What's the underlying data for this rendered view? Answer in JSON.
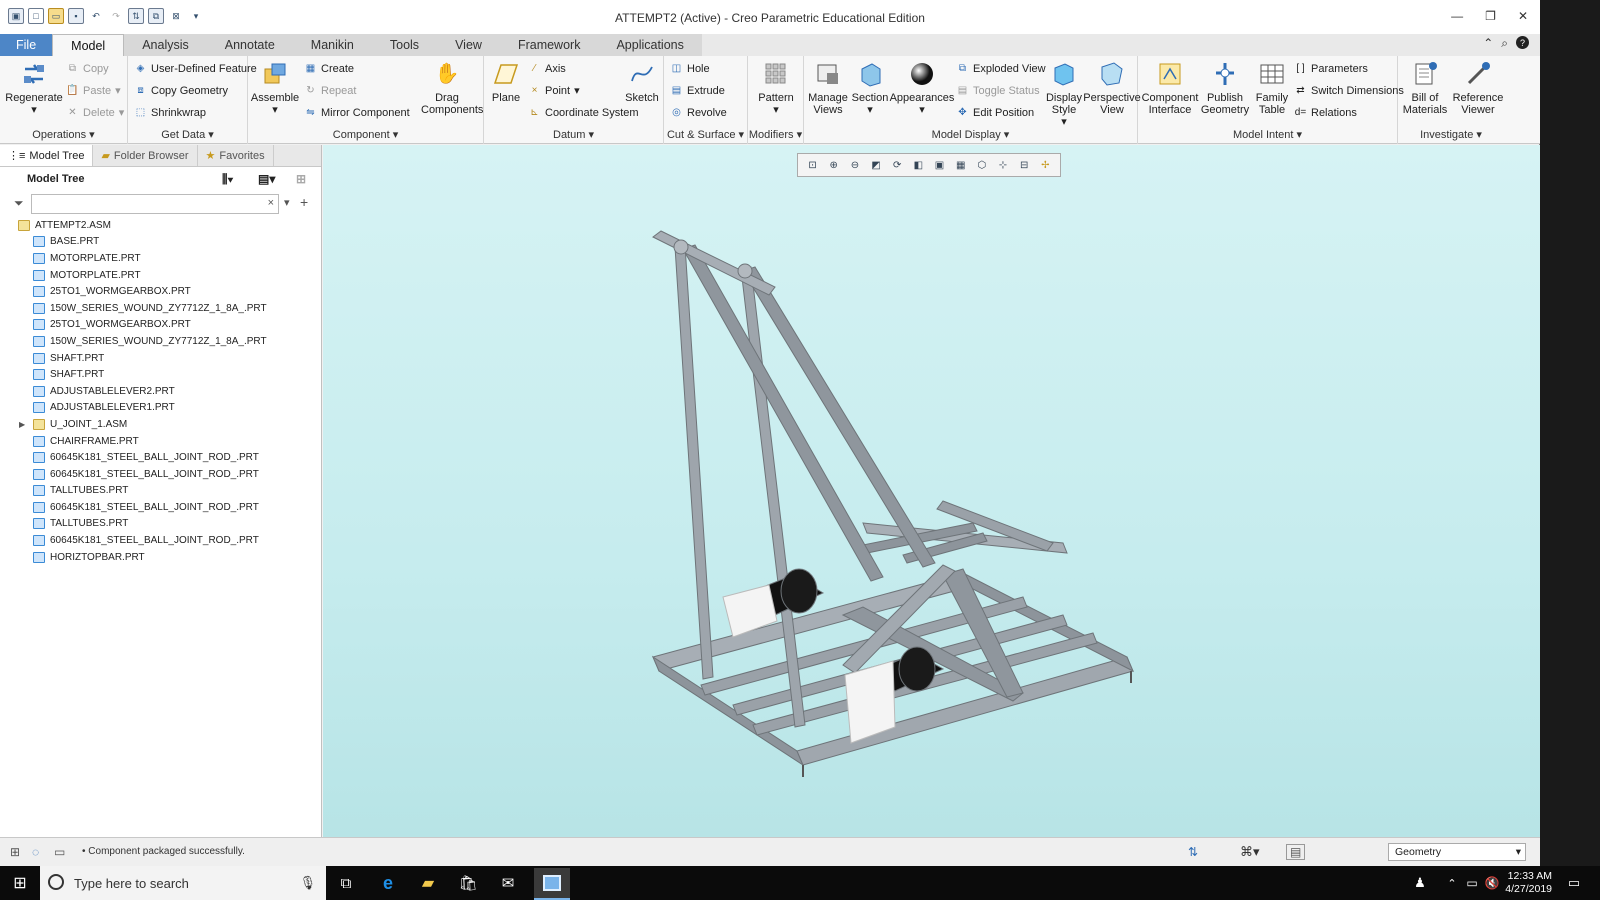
{
  "window": {
    "title": "ATTEMPT2 (Active) - Creo Parametric Educational Edition"
  },
  "tabs": [
    "File",
    "Model",
    "Analysis",
    "Annotate",
    "Manikin",
    "Tools",
    "View",
    "Framework",
    "Applications"
  ],
  "ribbon": {
    "operations": {
      "label": "Operations",
      "regenerate": "Regenerate",
      "copy": "Copy",
      "paste": "Paste",
      "delete": "Delete"
    },
    "get_data": {
      "label": "Get Data",
      "udf": "User-Defined Feature",
      "copy_geometry": "Copy Geometry",
      "shrinkwrap": "Shrinkwrap"
    },
    "component": {
      "label": "Component",
      "assemble": "Assemble",
      "create": "Create",
      "repeat": "Repeat",
      "mirror": "Mirror Component",
      "drag": "Drag Components"
    },
    "datum": {
      "label": "Datum",
      "plane": "Plane",
      "axis": "Axis",
      "point": "Point",
      "csys": "Coordinate System",
      "sketch": "Sketch"
    },
    "cut_surface": {
      "label": "Cut & Surface",
      "hole": "Hole",
      "extrude": "Extrude",
      "revolve": "Revolve"
    },
    "modifiers": {
      "label": "Modifiers",
      "pattern": "Pattern"
    },
    "model_display": {
      "label": "Model Display",
      "manage_views": "Manage Views",
      "section": "Section",
      "appearances": "Appearances",
      "exploded": "Exploded View",
      "toggle_status": "Toggle Status",
      "edit_position": "Edit Position",
      "display_style": "Display Style",
      "perspective": "Perspective View"
    },
    "model_intent": {
      "label": "Model Intent",
      "component_interface": "Component Interface",
      "publish_geometry": "Publish Geometry",
      "family_table": "Family Table",
      "parameters": "Parameters",
      "switch_dimensions": "Switch Dimensions",
      "relations": "Relations"
    },
    "investigate": {
      "label": "Investigate",
      "bom": "Bill of Materials",
      "reference_viewer": "Reference Viewer"
    }
  },
  "panel_tabs": [
    "Model Tree",
    "Folder Browser",
    "Favorites"
  ],
  "model_tree": {
    "header": "Model Tree",
    "items": [
      {
        "name": "ATTEMPT2.ASM",
        "type": "asm",
        "indent": 0
      },
      {
        "name": "BASE.PRT",
        "type": "prt",
        "indent": 1
      },
      {
        "name": "MOTORPLATE.PRT",
        "type": "prt",
        "indent": 1
      },
      {
        "name": "MOTORPLATE.PRT",
        "type": "prt",
        "indent": 1
      },
      {
        "name": "25TO1_WORMGEARBOX.PRT",
        "type": "prt",
        "indent": 1
      },
      {
        "name": "150W_SERIES_WOUND_ZY7712Z_1_8A_.PRT",
        "type": "prt",
        "indent": 1
      },
      {
        "name": "25TO1_WORMGEARBOX.PRT",
        "type": "prt",
        "indent": 1
      },
      {
        "name": "150W_SERIES_WOUND_ZY7712Z_1_8A_.PRT",
        "type": "prt",
        "indent": 1
      },
      {
        "name": "SHAFT.PRT",
        "type": "prt",
        "indent": 1
      },
      {
        "name": "SHAFT.PRT",
        "type": "prt",
        "indent": 1
      },
      {
        "name": "ADJUSTABLELEVER2.PRT",
        "type": "prt",
        "indent": 1
      },
      {
        "name": "ADJUSTABLELEVER1.PRT",
        "type": "prt",
        "indent": 1
      },
      {
        "name": "U_JOINT_1.ASM",
        "type": "asm",
        "indent": 1
      },
      {
        "name": "CHAIRFRAME.PRT",
        "type": "prt",
        "indent": 1
      },
      {
        "name": "60645K181_STEEL_BALL_JOINT_ROD_.PRT",
        "type": "prt",
        "indent": 1
      },
      {
        "name": "60645K181_STEEL_BALL_JOINT_ROD_.PRT",
        "type": "prt",
        "indent": 1
      },
      {
        "name": "TALLTUBES.PRT",
        "type": "prt",
        "indent": 1
      },
      {
        "name": "60645K181_STEEL_BALL_JOINT_ROD_.PRT",
        "type": "prt",
        "indent": 1
      },
      {
        "name": "TALLTUBES.PRT",
        "type": "prt",
        "indent": 1
      },
      {
        "name": "60645K181_STEEL_BALL_JOINT_ROD_.PRT",
        "type": "prt",
        "indent": 1
      },
      {
        "name": "HORIZTOPBAR.PRT",
        "type": "prt",
        "indent": 1
      }
    ]
  },
  "status": {
    "message": "Component packaged successfully.",
    "filter": "Geometry"
  },
  "taskbar": {
    "search_placeholder": "Type here to search",
    "time": "12:33 AM",
    "date": "4/27/2019"
  }
}
